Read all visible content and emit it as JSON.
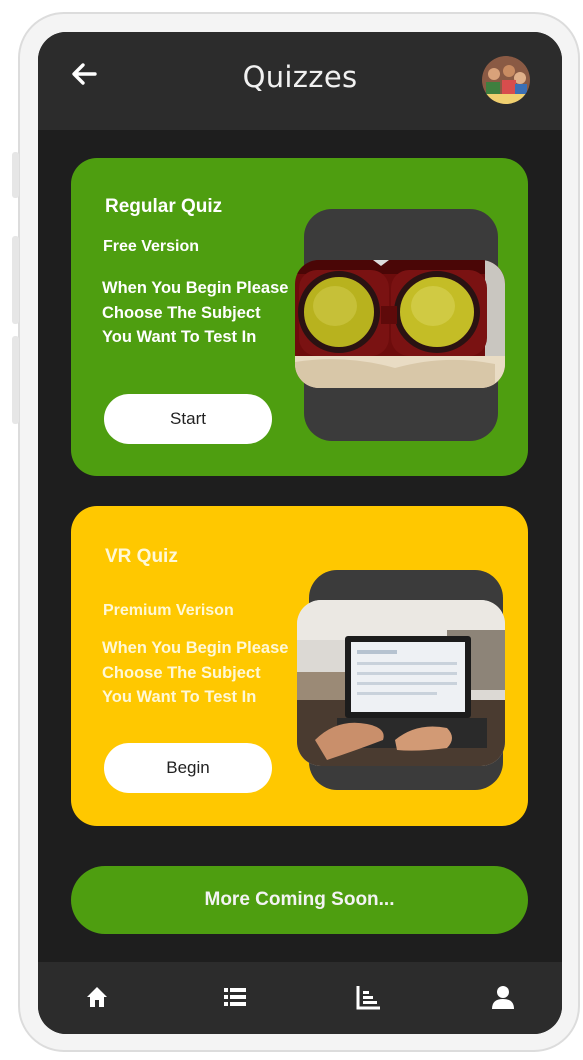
{
  "header": {
    "title": "Quizzes",
    "back_icon": "arrow-left-icon",
    "avatar": "user-avatar"
  },
  "cards": [
    {
      "title": "Regular Quiz",
      "subtitle": "Free Version",
      "description": "When You Begin Please Choose The Subject You Want To Test In",
      "button": "Start",
      "color": "#4e9e10",
      "image": "vr-headset-on-book-image"
    },
    {
      "title": "VR Quiz",
      "subtitle": "Premium Verison",
      "description": "When You Begin Please Choose The Subject You Want To Test In",
      "button": "Begin",
      "color": "#ffc800",
      "image": "laptop-typing-image"
    }
  ],
  "more": {
    "label": "More Coming Soon..."
  },
  "bottom_nav": [
    {
      "icon": "home-icon"
    },
    {
      "icon": "list-icon"
    },
    {
      "icon": "chart-icon"
    },
    {
      "icon": "user-icon"
    }
  ],
  "colors": {
    "background": "#1e1e1e",
    "bar": "#2c2c2c",
    "green": "#4e9e10",
    "yellow": "#ffc800"
  }
}
